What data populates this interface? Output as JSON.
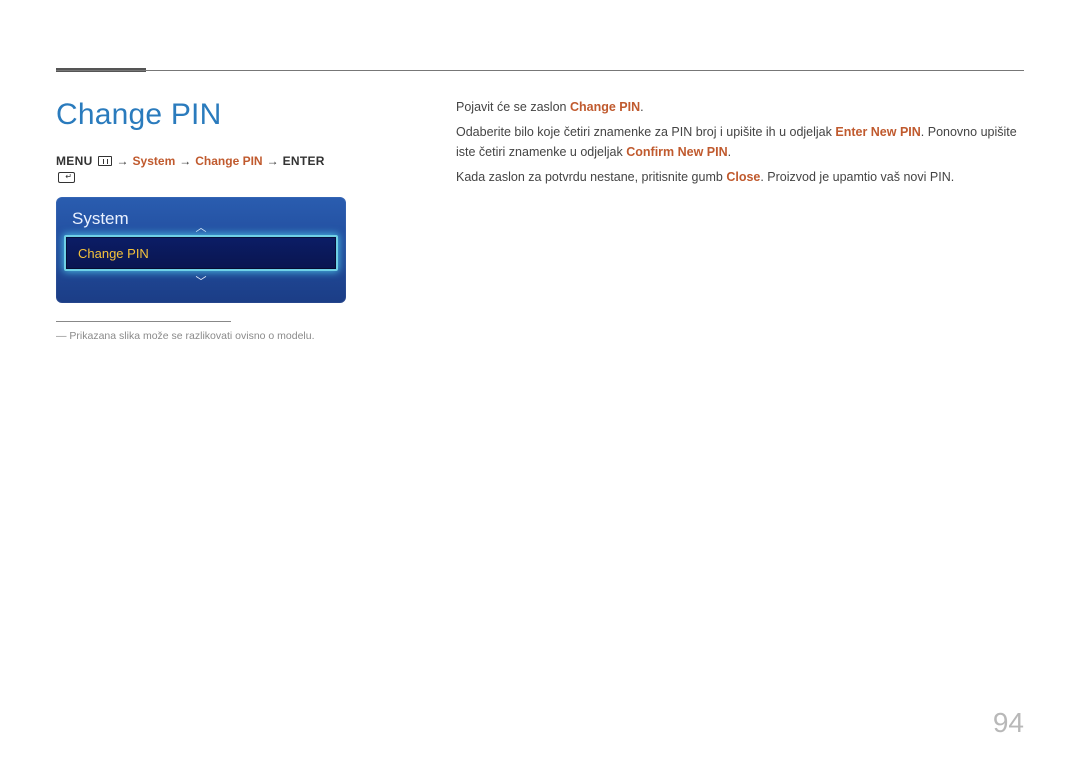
{
  "title": "Change PIN",
  "breadcrumb": {
    "menu": "MENU",
    "system": "System",
    "change_pin": "Change PIN",
    "enter": "ENTER"
  },
  "osd": {
    "header": "System",
    "selected": "Change PIN"
  },
  "footnote": "― Prikazana slika može se razlikovati ovisno o modelu.",
  "body": {
    "p1_a": "Pojavit će se zaslon ",
    "p1_hl": "Change PIN",
    "p1_b": ".",
    "p2_a": "Odaberite bilo koje četiri znamenke za PIN broj i upišite ih u odjeljak ",
    "p2_hl1": "Enter New PIN",
    "p2_b": ". Ponovno upišite iste četiri znamenke u odjeljak ",
    "p2_hl2": "Confirm New PIN",
    "p2_c": ".",
    "p3_a": "Kada zaslon za potvrdu nestane, pritisnite gumb ",
    "p3_hl": "Close",
    "p3_b": ". Proizvod je upamtio vaš novi PIN."
  },
  "page_number": "94"
}
